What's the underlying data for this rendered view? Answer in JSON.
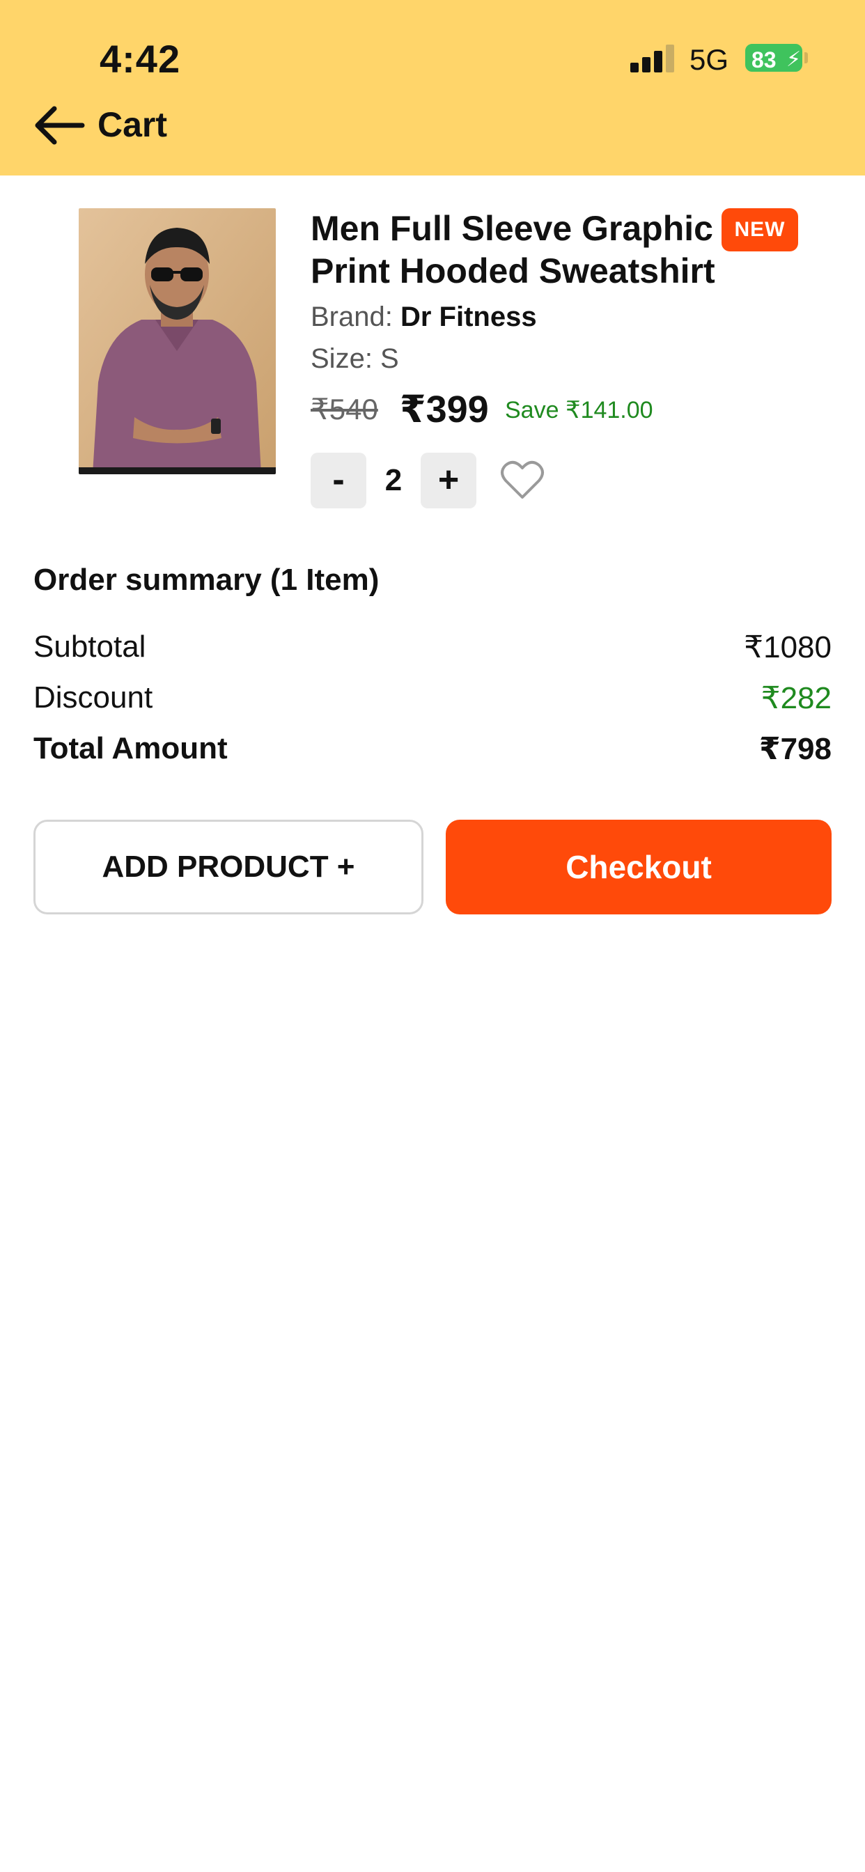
{
  "status_bar": {
    "time": "4:42",
    "network": "5G",
    "battery": "83"
  },
  "header": {
    "title": "Cart",
    "background": "#FFD56A"
  },
  "cart_item": {
    "title": "Men Full Sleeve Graphic Print Hooded Sweatshirt",
    "badge": "NEW",
    "brand_label": "Brand:",
    "brand": "Dr Fitness",
    "size": "Size: S",
    "mrp": "₹540",
    "price": "₹399",
    "save": "Save ₹141.00",
    "quantity": "2",
    "minus_label": "-",
    "plus_label": "+"
  },
  "summary": {
    "title": "Order summary (1 Item)",
    "subtotal_label": "Subtotal",
    "subtotal_value": "₹1080",
    "discount_label": "Discount",
    "discount_value": "₹282",
    "total_label": "Total Amount",
    "total_value": "₹798"
  },
  "actions": {
    "add_product": "ADD PRODUCT +",
    "checkout": "Checkout"
  },
  "colors": {
    "accent": "#FF4A0A",
    "discount_green": "#1f8a1f"
  },
  "icons": {
    "back": "arrow-left-icon",
    "wishlist": "heart-outline-icon",
    "signal": "cellular-signal-icon",
    "battery": "battery-charging-icon"
  }
}
